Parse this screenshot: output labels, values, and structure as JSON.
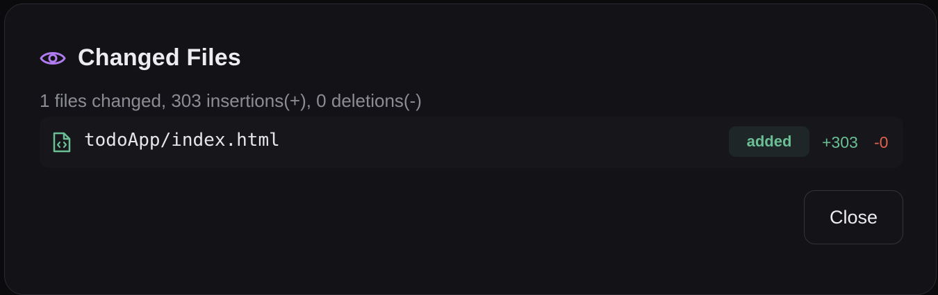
{
  "dialog": {
    "title": "Changed Files",
    "title_icon": "eye-icon",
    "summary": "1 files changed, 303 insertions(+), 0 deletions(-)",
    "close_label": "Close"
  },
  "files": [
    {
      "icon": "file-code-icon",
      "path": "todoApp/index.html",
      "status": "added",
      "insertions": "+303",
      "deletions": "-0"
    }
  ],
  "colors": {
    "accent": "#b07cf0",
    "added": "#6bbf95",
    "deleted": "#e0604f",
    "background": "#131317"
  }
}
